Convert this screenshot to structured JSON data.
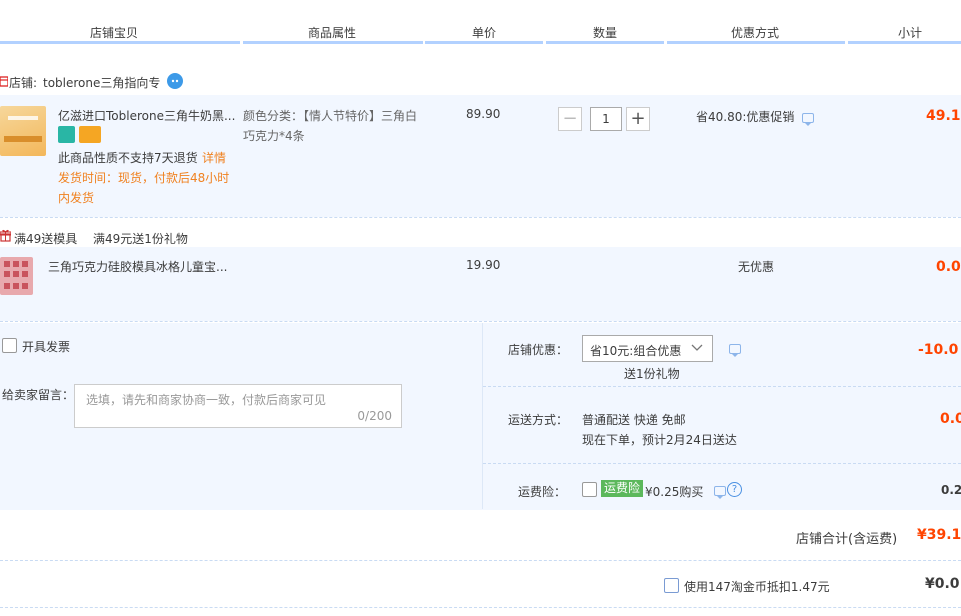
{
  "header": {
    "col_shop_item": "店铺宝贝",
    "col_attributes": "商品属性",
    "col_price": "单价",
    "col_quantity": "数量",
    "col_discount": "优惠方式",
    "col_subtotal": "小计"
  },
  "shop": {
    "label": "店铺:",
    "name": "toblerone三角指向专"
  },
  "item1": {
    "title": "亿滋进口Toblerone三角牛奶黑...",
    "notice": "此商品性质不支持7天退货",
    "details_link": "详情",
    "ship_time_line1": "发货时间：现货，付款后48小时",
    "ship_time_line2": "内发货",
    "attr_line1": "颜色分类：【情人节特价】三角白",
    "attr_line2": "巧克力*4条",
    "price": "89.90",
    "quantity": "1",
    "minus": "−",
    "plus": "+",
    "discount": "省40.80:优惠促销",
    "subtotal": "49.1"
  },
  "promo": {
    "tag": "满49送模具",
    "desc": "满49元送1份礼物"
  },
  "item2": {
    "title": "三角巧克力硅胶模具冰格儿童宝...",
    "price": "19.90",
    "discount": "无优惠",
    "subtotal": "0.0"
  },
  "invoice": {
    "label": "开具发票"
  },
  "message": {
    "label": "给卖家留言：",
    "placeholder": "选填，请先和商家协商一致，付款后商家可见",
    "counter": "0/200"
  },
  "shop_discount": {
    "label": "店铺优惠：",
    "selected": "省10元:组合优惠",
    "gift": "送1份礼物",
    "amount": "-10.0"
  },
  "shipping": {
    "label": "运送方式：",
    "method": "普通配送 快递 免邮",
    "eta": "现在下单，预计2月24日送达",
    "amount": "0.0"
  },
  "insurance": {
    "label": "运费险：",
    "tag": "运费险",
    "price_text": "¥0.25购买",
    "help": "?",
    "amount": "0.2"
  },
  "shop_total": {
    "label": "店铺合计(含运费)",
    "amount": "¥39.1"
  },
  "coins": {
    "label": "使用147淘金币抵扣1.47元",
    "amount": "¥0.0"
  },
  "colors": {
    "accent_blue": "#b2d1ff",
    "price_red": "#ff4400",
    "notice_orange": "#f08221",
    "row_bg": "#f2f7ff"
  }
}
